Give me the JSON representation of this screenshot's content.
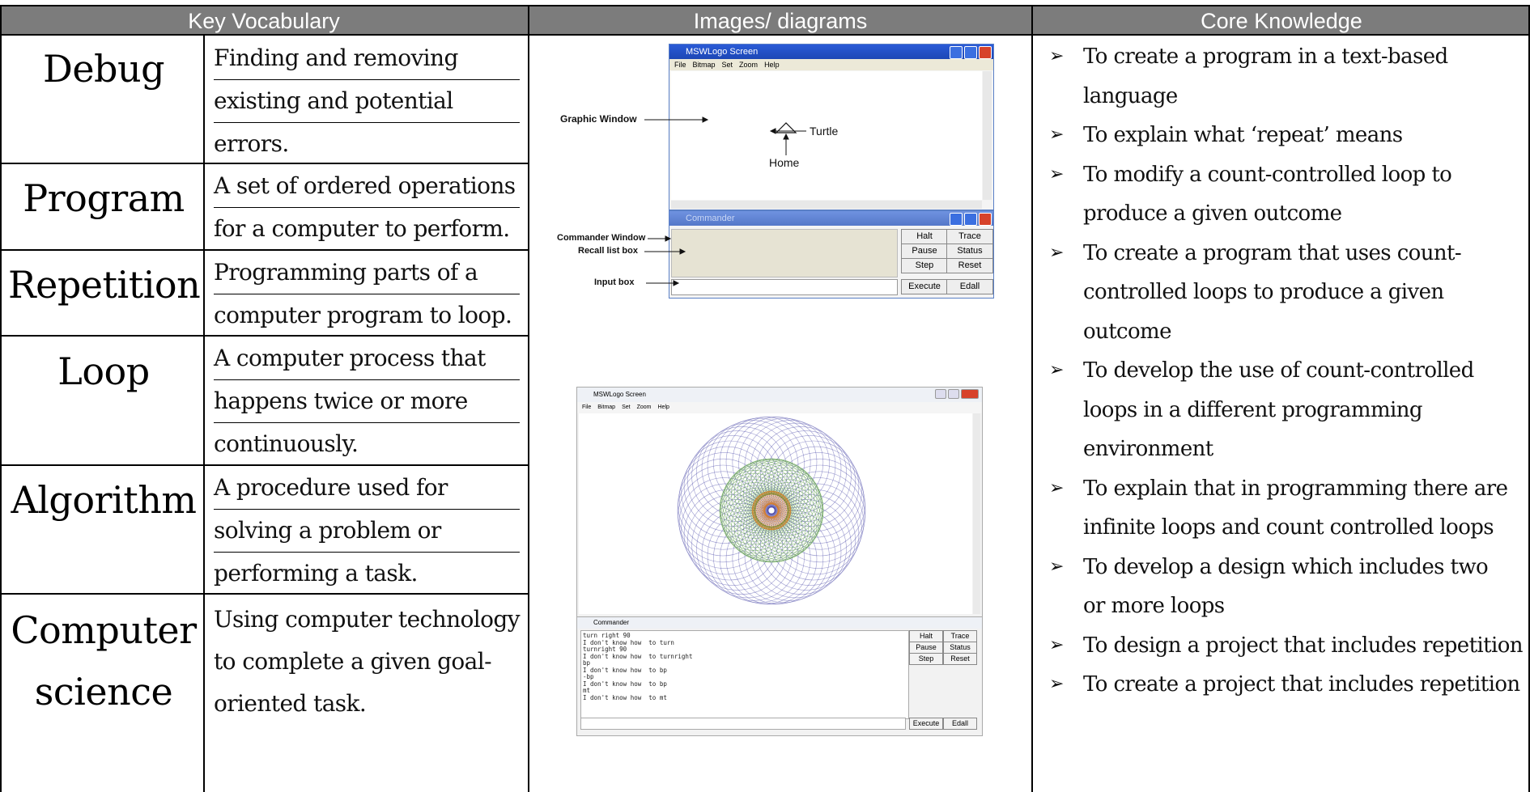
{
  "headers": {
    "vocabulary": "Key Vocabulary",
    "images": "Images/ diagrams",
    "knowledge": "Core Knowledge"
  },
  "vocabulary": [
    {
      "term": [
        "Debug"
      ],
      "definition": [
        "Finding and removing",
        "existing and potential",
        "errors."
      ]
    },
    {
      "term": [
        "Program"
      ],
      "definition": [
        "A set of ordered operations",
        "for a computer to perform."
      ]
    },
    {
      "term": [
        "Repetition"
      ],
      "definition": [
        "Programming parts of a",
        "computer program to loop."
      ]
    },
    {
      "term": [
        "Loop"
      ],
      "definition": [
        "A computer process that",
        "happens twice or more",
        "continuously."
      ]
    },
    {
      "term": [
        "Algorithm"
      ],
      "definition": [
        "A procedure used for",
        "solving a problem or",
        "performing a task."
      ]
    },
    {
      "term": [
        "Computer",
        "science"
      ],
      "definition": [
        "Using computer technology",
        "to complete a given goal-",
        "oriented task."
      ]
    }
  ],
  "core_knowledge": [
    [
      "To create a program in a text-based",
      "language"
    ],
    [
      "To explain what ‘repeat’ means"
    ],
    [
      "To modify a count-controlled loop to",
      "produce a given outcome"
    ],
    [
      "To create a program that uses count-",
      "controlled loops to produce a given",
      "outcome"
    ],
    [
      "To develop the use of count-controlled",
      "loops in a different programming",
      "environment"
    ],
    [
      "To explain that in programming there are",
      "infinite loops and count controlled loops"
    ],
    [
      "To develop a design which includes two",
      "or more loops"
    ],
    [
      "To design a project that includes repetition"
    ],
    [
      "To create a project that includes repetition"
    ]
  ],
  "diagram1": {
    "window_title": "MSWLogo Screen",
    "menu": [
      "File",
      "Bitmap",
      "Set",
      "Zoom",
      "Help"
    ],
    "commander_title": "Commander",
    "labels": {
      "graphic_window": "Graphic Window",
      "turtle": "Turtle",
      "home": "Home",
      "commander_window": "Commander Window",
      "recall_list_box": "Recall list box",
      "input_box": "Input box"
    },
    "buttons": [
      "Halt",
      "Trace",
      "Pause",
      "Status",
      "Step",
      "Reset",
      "Execute",
      "Edall"
    ]
  },
  "diagram2": {
    "window_title": "MSWLogo Screen",
    "menu": [
      "File",
      "Bitmap",
      "Set",
      "Zoom",
      "Help"
    ],
    "commander_title": "Commander",
    "console_lines": [
      "turn right 90",
      "I don't know how  to turn",
      "turnright 90",
      "I don't know how  to turnright",
      "bp",
      "I don't know how  to bp",
      "-bp",
      "I don't know how  to bp",
      "mt",
      "I don't know how  to mt"
    ],
    "buttons": [
      "Halt",
      "Trace",
      "Pause",
      "Status",
      "Step",
      "Reset",
      "Execute",
      "Edall"
    ]
  },
  "bullet_glyph": "➢",
  "colors": {
    "header_bg": "#7c7c7c",
    "header_text": "#ffffff",
    "title_blue": "#2a5bd7",
    "spiro_outer": "#4a48a8",
    "spiro_inner": "#3f8a2a",
    "spiro_core": "#e07a10"
  }
}
